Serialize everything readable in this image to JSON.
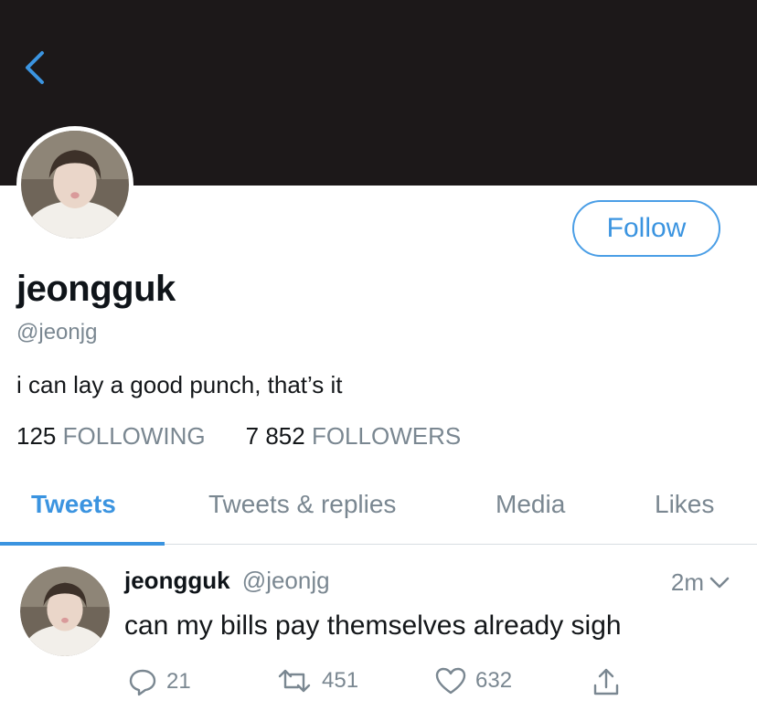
{
  "profile": {
    "name": "jeongguk",
    "handle": "@jeonjg",
    "bio": "i can lay a good punch, that’s it",
    "following_count": "125",
    "following_label": "FOLLOWING",
    "followers_count": "7 852",
    "followers_label": "FOLLOWERS",
    "follow_label": "Follow"
  },
  "tabs": [
    {
      "label": "Tweets",
      "active": true
    },
    {
      "label": "Tweets & replies",
      "active": false
    },
    {
      "label": "Media",
      "active": false
    },
    {
      "label": "Likes",
      "active": false
    }
  ],
  "tweet": {
    "name": "jeongguk",
    "handle": "@jeonjg",
    "time": "2m",
    "text": "can my bills pay themselves already sigh",
    "replies": "21",
    "retweets": "451",
    "likes": "632"
  },
  "colors": {
    "accent": "#3b94e0",
    "banner": "#1c1819",
    "muted": "#7a8791"
  },
  "icons": [
    "back-chevron-icon",
    "chevron-down-icon",
    "reply-icon",
    "retweet-icon",
    "heart-icon",
    "share-icon"
  ]
}
